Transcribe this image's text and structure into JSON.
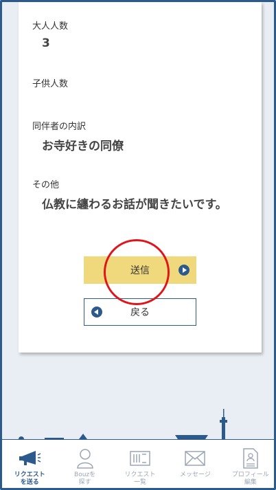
{
  "form": {
    "adults": {
      "label": "大人人数",
      "value": "3"
    },
    "children": {
      "label": "子供人数",
      "value": ""
    },
    "companion": {
      "label": "同伴者の内訳",
      "value": "お寺好きの同僚"
    },
    "other": {
      "label": "その他",
      "value": "仏教に纏わるお話が聞きたいです。"
    }
  },
  "buttons": {
    "send": "送信",
    "back": "戻る"
  },
  "tabbar": {
    "items": [
      {
        "label": "リクエスト\nを送る",
        "icon": "megaphone-icon",
        "active": true
      },
      {
        "label": "Bouzを\n探す",
        "icon": "monk-icon",
        "active": false
      },
      {
        "label": "リクエスト\n一覧",
        "icon": "list-icon",
        "active": false
      },
      {
        "label": "メッセージ",
        "icon": "envelope-icon",
        "active": false
      },
      {
        "label": "プロフィール\n編集",
        "icon": "document-icon",
        "active": false
      }
    ]
  },
  "colors": {
    "accent": "#2c5a8c",
    "send_bg": "#f0d97c",
    "highlight": "#e0151b"
  }
}
